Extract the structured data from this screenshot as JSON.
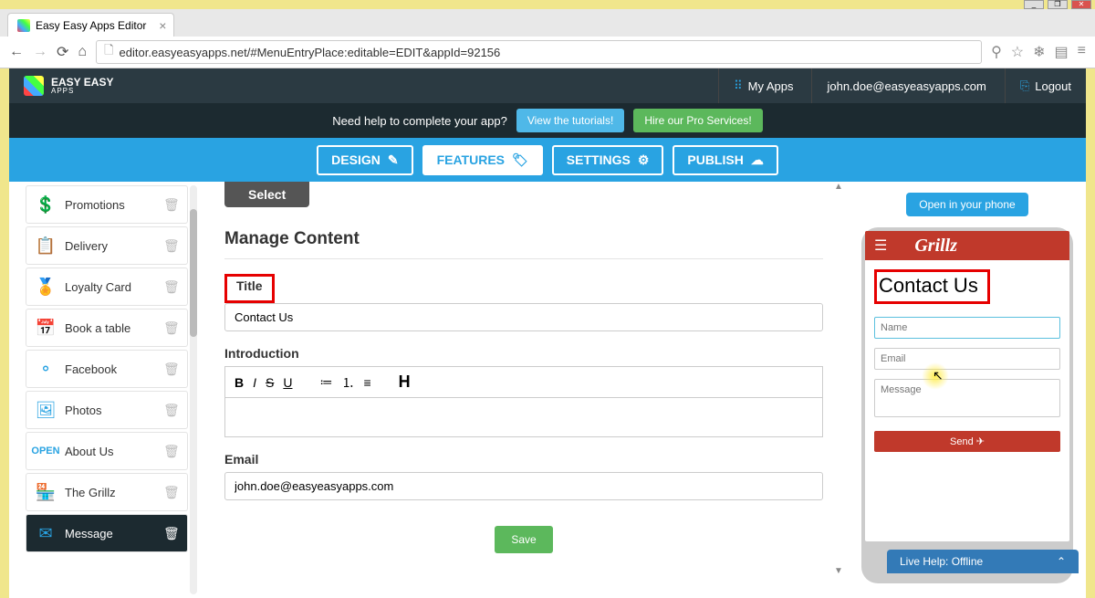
{
  "browser": {
    "tab_title": "Easy Easy Apps Editor",
    "url": "editor.easyeasyapps.net/#MenuEntryPlace:editable=EDIT&appId=92156"
  },
  "header": {
    "brand_line1": "EASY EASY",
    "brand_line2": "APPS",
    "my_apps": "My Apps",
    "user_email": "john.doe@easyeasyapps.com",
    "logout": "Logout"
  },
  "help": {
    "text": "Need help to complete your app?",
    "tutorials_btn": "View the tutorials!",
    "pro_btn": "Hire our Pro Services!"
  },
  "modes": {
    "design": "DESIGN",
    "features": "FEATURES",
    "settings": "SETTINGS",
    "publish": "PUBLISH"
  },
  "sidebar": {
    "items": [
      {
        "label": "Promotions",
        "icon": "💲"
      },
      {
        "label": "Delivery",
        "icon": "📋"
      },
      {
        "label": "Loyalty Card",
        "icon": "🏅"
      },
      {
        "label": "Book a table",
        "icon": "📅"
      },
      {
        "label": "Facebook",
        "icon": "⚬"
      },
      {
        "label": "Photos",
        "icon": "🖼"
      },
      {
        "label": "About Us",
        "icon": "ℹ"
      },
      {
        "label": "The Grillz",
        "icon": "🏪"
      },
      {
        "label": "Message",
        "icon": "✉"
      }
    ]
  },
  "content": {
    "select_btn": "Select",
    "section_title": "Manage Content",
    "title_label": "Title",
    "title_value": "Contact Us",
    "intro_label": "Introduction",
    "email_label": "Email",
    "email_value": "john.doe@easyeasyapps.com",
    "save_btn": "Save"
  },
  "preview": {
    "open_btn": "Open in your phone",
    "brand": "Grillz",
    "heading": "Contact Us",
    "name_ph": "Name",
    "email_ph": "Email",
    "message_ph": "Message",
    "send_btn": "Send"
  },
  "live_help": "Live Help: Offline"
}
